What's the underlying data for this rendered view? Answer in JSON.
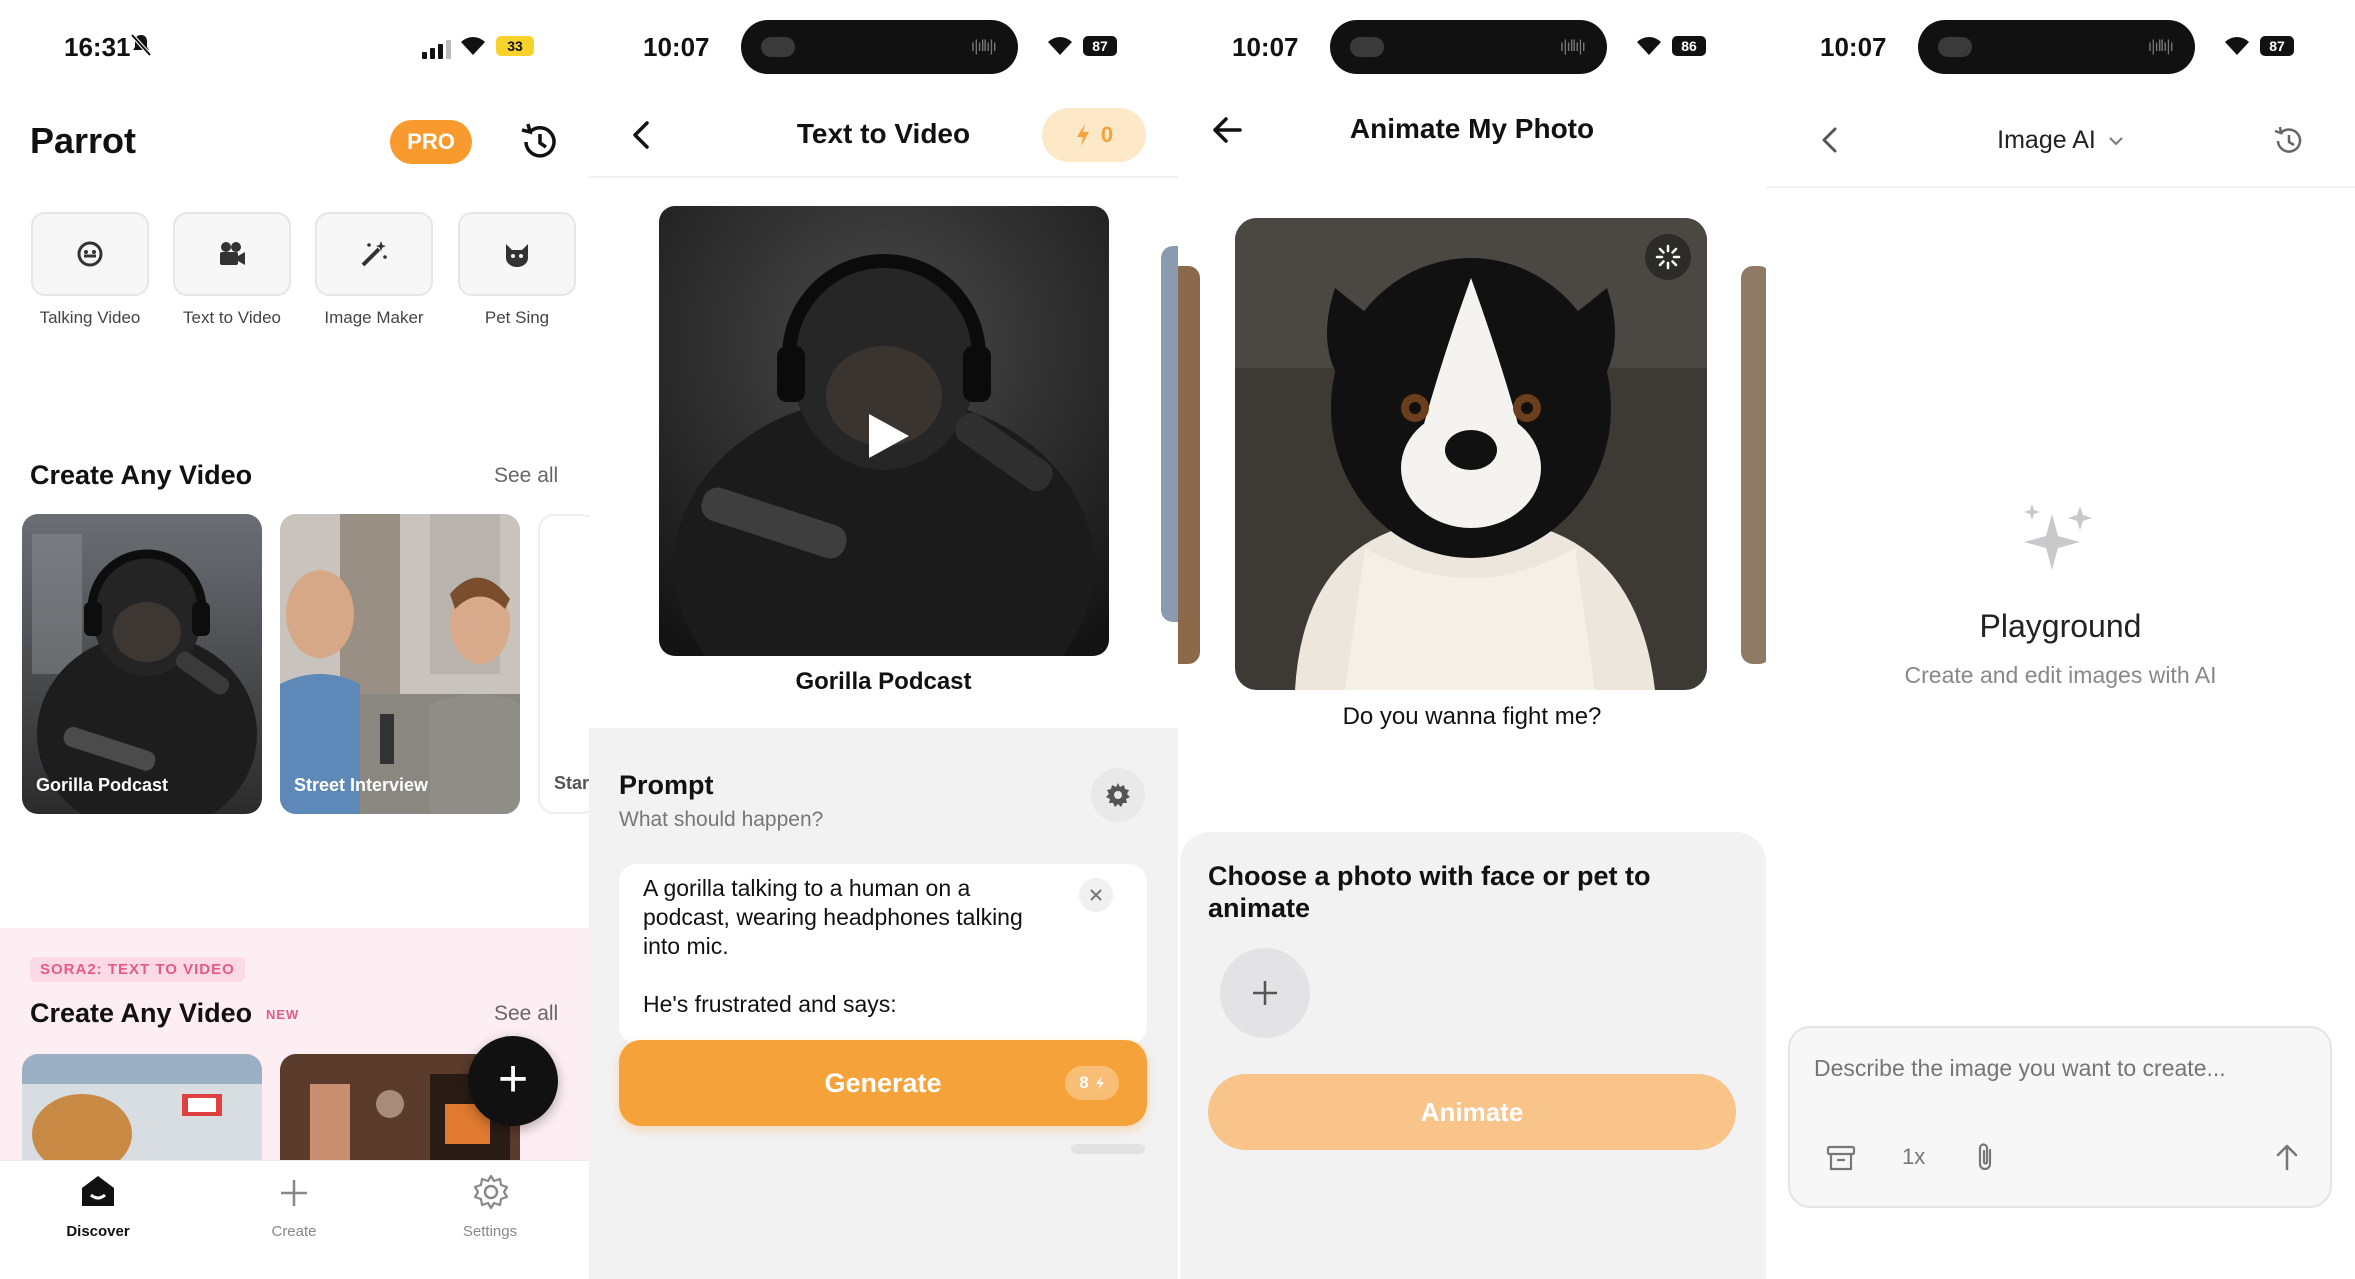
{
  "screen1": {
    "status_time": "16:31",
    "battery": "33",
    "app_title": "Parrot",
    "pro_label": "PRO",
    "features": [
      {
        "label": "Talking Video",
        "icon": "face-icon"
      },
      {
        "label": "Text to Video",
        "icon": "video-camera-icon"
      },
      {
        "label": "Image Maker",
        "icon": "magic-wand-icon"
      },
      {
        "label": "Pet Sing",
        "icon": "cat-icon"
      }
    ],
    "section1": {
      "title": "Create Any Video",
      "see_all": "See all",
      "cards": [
        "Gorilla Podcast",
        "Street Interview",
        "Star"
      ]
    },
    "section2": {
      "tag": "SORA2: TEXT TO VIDEO",
      "title": "Create Any Video",
      "badge": "NEW",
      "see_all": "See all"
    },
    "tabs": [
      {
        "label": "Discover",
        "icon": "home-icon"
      },
      {
        "label": "Create",
        "icon": "plus-icon"
      },
      {
        "label": "Settings",
        "icon": "gear-icon"
      }
    ],
    "fab_label": "+"
  },
  "screen2": {
    "status_time": "10:07",
    "battery": "87",
    "title": "Text to Video",
    "credits": "0",
    "featured_caption": "Gorilla Podcast",
    "prompt_title": "Prompt",
    "prompt_subtitle": "What should happen?",
    "prompt_text_lines": [
      "A gorilla talking to a human on a",
      "podcast, wearing headphones talking",
      "into mic.",
      "",
      "He's frustrated and says:"
    ],
    "generate_label": "Generate",
    "generate_cost": "8"
  },
  "screen3": {
    "status_time": "10:07",
    "battery": "86",
    "title": "Animate My Photo",
    "photo_caption": "Do you wanna fight me?",
    "choose_line1": "Choose a photo with face or pet to",
    "choose_line2": "animate",
    "animate_label": "Animate"
  },
  "screen4": {
    "status_time": "10:07",
    "battery": "87",
    "title": "Image AI",
    "empty_title": "Playground",
    "empty_subtitle": "Create and edit images with AI",
    "input_placeholder": "Describe the image you want to create...",
    "zoom_label": "1x"
  },
  "colors": {
    "accent_orange": "#f6a23a",
    "pro_orange": "#f89a2e",
    "pink_band": "#fdeef3",
    "tag_pink": "#e55a86",
    "disabled_orange": "#f8c48a",
    "credit_bg": "#fde9c8"
  }
}
